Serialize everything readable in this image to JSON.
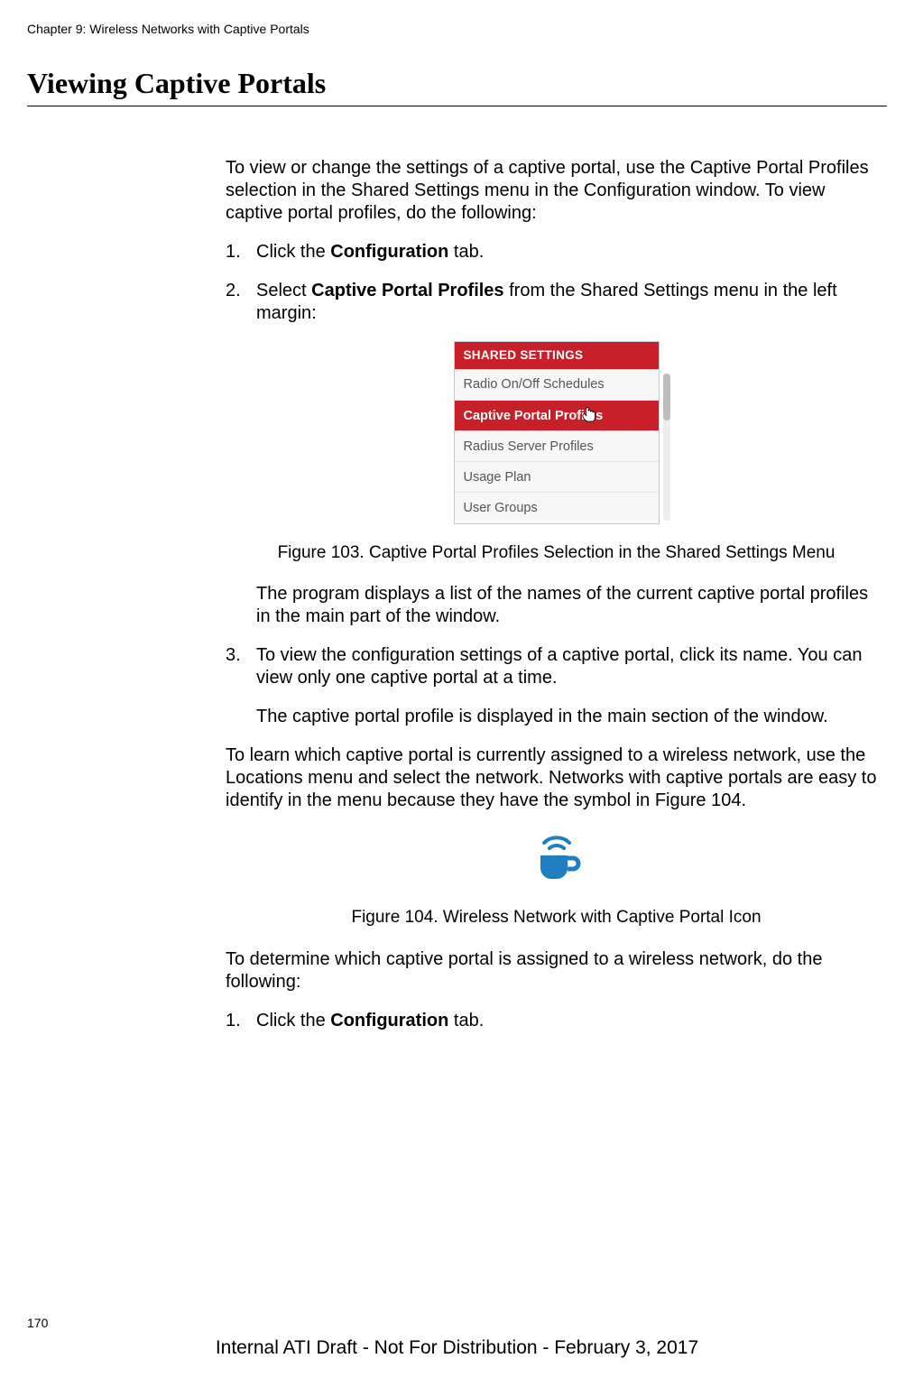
{
  "chapterHeader": "Chapter 9: Wireless Networks with Captive Portals",
  "sectionTitle": "Viewing Captive Portals",
  "intro": "To view or change the settings of a captive portal, use the Captive Portal Profiles selection in the Shared Settings menu in the Configuration window. To view captive portal profiles, do the following:",
  "steps1": {
    "s1num": "1.",
    "s1a": "Click the ",
    "s1b": "Configuration",
    "s1c": " tab.",
    "s2num": "2.",
    "s2a": "Select ",
    "s2b": "Captive Portal Profiles",
    "s2c": " from the Shared Settings menu in the left margin:"
  },
  "menu": {
    "header": "SHARED SETTINGS",
    "items": [
      "Radio On/Off Schedules",
      "Captive Portal Profiles",
      "Radius Server Profiles",
      "Usage Plan",
      "User Groups"
    ]
  },
  "fig103": "Figure 103. Captive Portal Profiles Selection in the Shared Settings Menu",
  "afterFig103_1": "The program displays a list of the names of the current captive portal profiles in the main part of the window.",
  "s3num": "3.",
  "s3line1": "To view the configuration settings of a captive portal, click its name. You can view only one captive portal at a time.",
  "s3line2": "The captive portal profile is displayed in the main section of the window.",
  "para_learn": "To learn which captive portal is currently assigned to a wireless network, use the Locations menu and select the network. Networks with captive portals are easy to identify in the menu because they have the symbol in Figure 104.",
  "fig104": "Figure 104. Wireless Network with Captive Portal Icon",
  "para_determine": "To determine which captive portal is assigned to a wireless network, do the following:",
  "steps2": {
    "s1num": "1.",
    "s1a": "Click the ",
    "s1b": "Configuration",
    "s1c": " tab."
  },
  "pageNumber": "170",
  "footer": "Internal ATI Draft - Not For Distribution - February 3, 2017"
}
